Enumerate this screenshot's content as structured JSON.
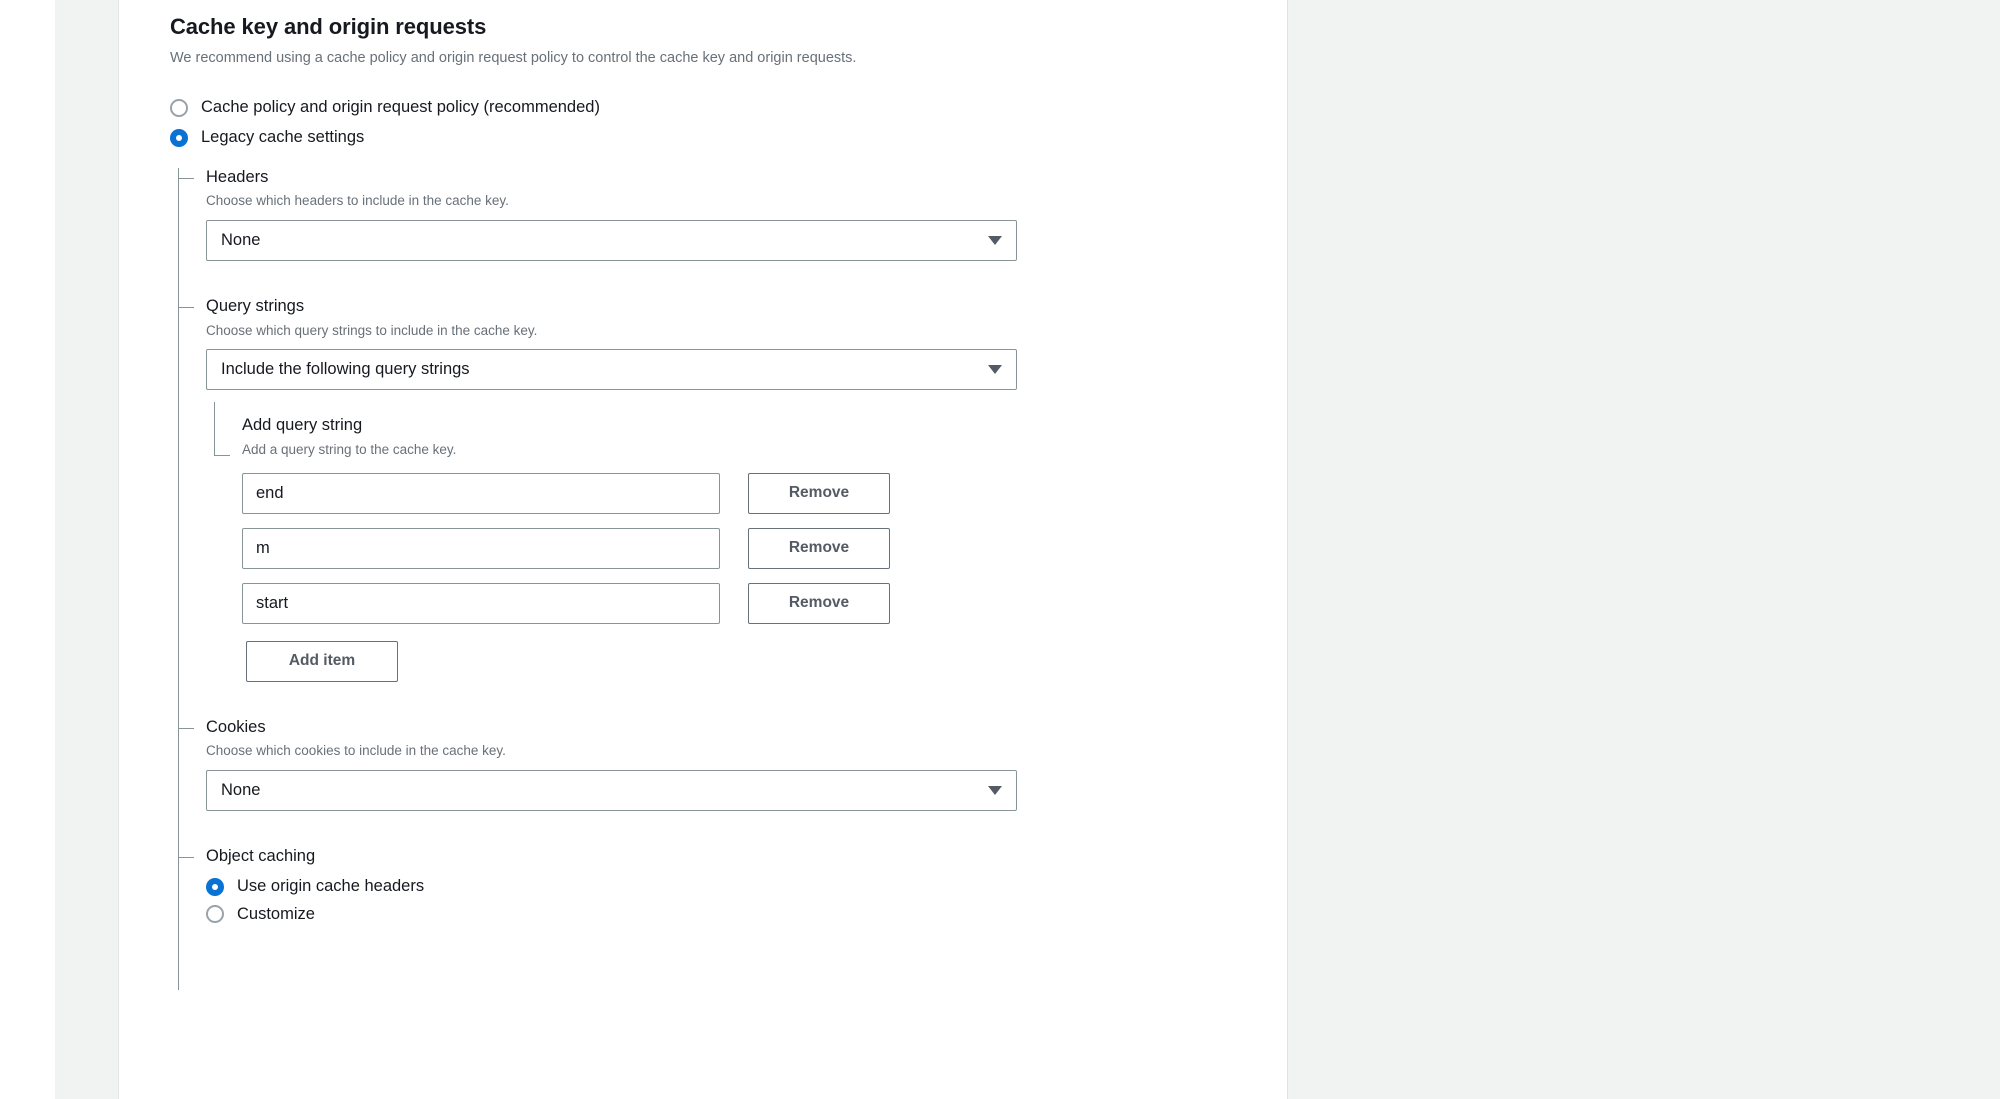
{
  "section": {
    "title": "Cache key and origin requests",
    "description": "We recommend using a cache policy and origin request policy to control the cache key and origin requests."
  },
  "policy_mode": {
    "options": [
      {
        "label": "Cache policy and origin request policy (recommended)",
        "selected": false
      },
      {
        "label": "Legacy cache settings",
        "selected": true
      }
    ]
  },
  "legacy": {
    "headers": {
      "label": "Headers",
      "description": "Choose which headers to include in the cache key.",
      "value": "None"
    },
    "query_strings": {
      "label": "Query strings",
      "description": "Choose which query strings to include in the cache key.",
      "value": "Include the following query strings",
      "add_query_string": {
        "label": "Add query string",
        "description": "Add a query string to the cache key.",
        "items": [
          {
            "value": "end",
            "remove_label": "Remove"
          },
          {
            "value": "m",
            "remove_label": "Remove"
          },
          {
            "value": "start",
            "remove_label": "Remove"
          }
        ],
        "add_item_label": "Add item"
      }
    },
    "cookies": {
      "label": "Cookies",
      "description": "Choose which cookies to include in the cache key.",
      "value": "None"
    },
    "object_caching": {
      "label": "Object caching",
      "options": [
        {
          "label": "Use origin cache headers",
          "selected": true
        },
        {
          "label": "Customize",
          "selected": false
        }
      ]
    }
  },
  "colors": {
    "accent": "#0972d3",
    "text": "#16191f",
    "muted": "#687078",
    "border": "#879596",
    "panel_bg": "#ffffff",
    "page_bg": "#f1f3f3"
  },
  "icons": {
    "caret": "chevron-down-icon"
  }
}
